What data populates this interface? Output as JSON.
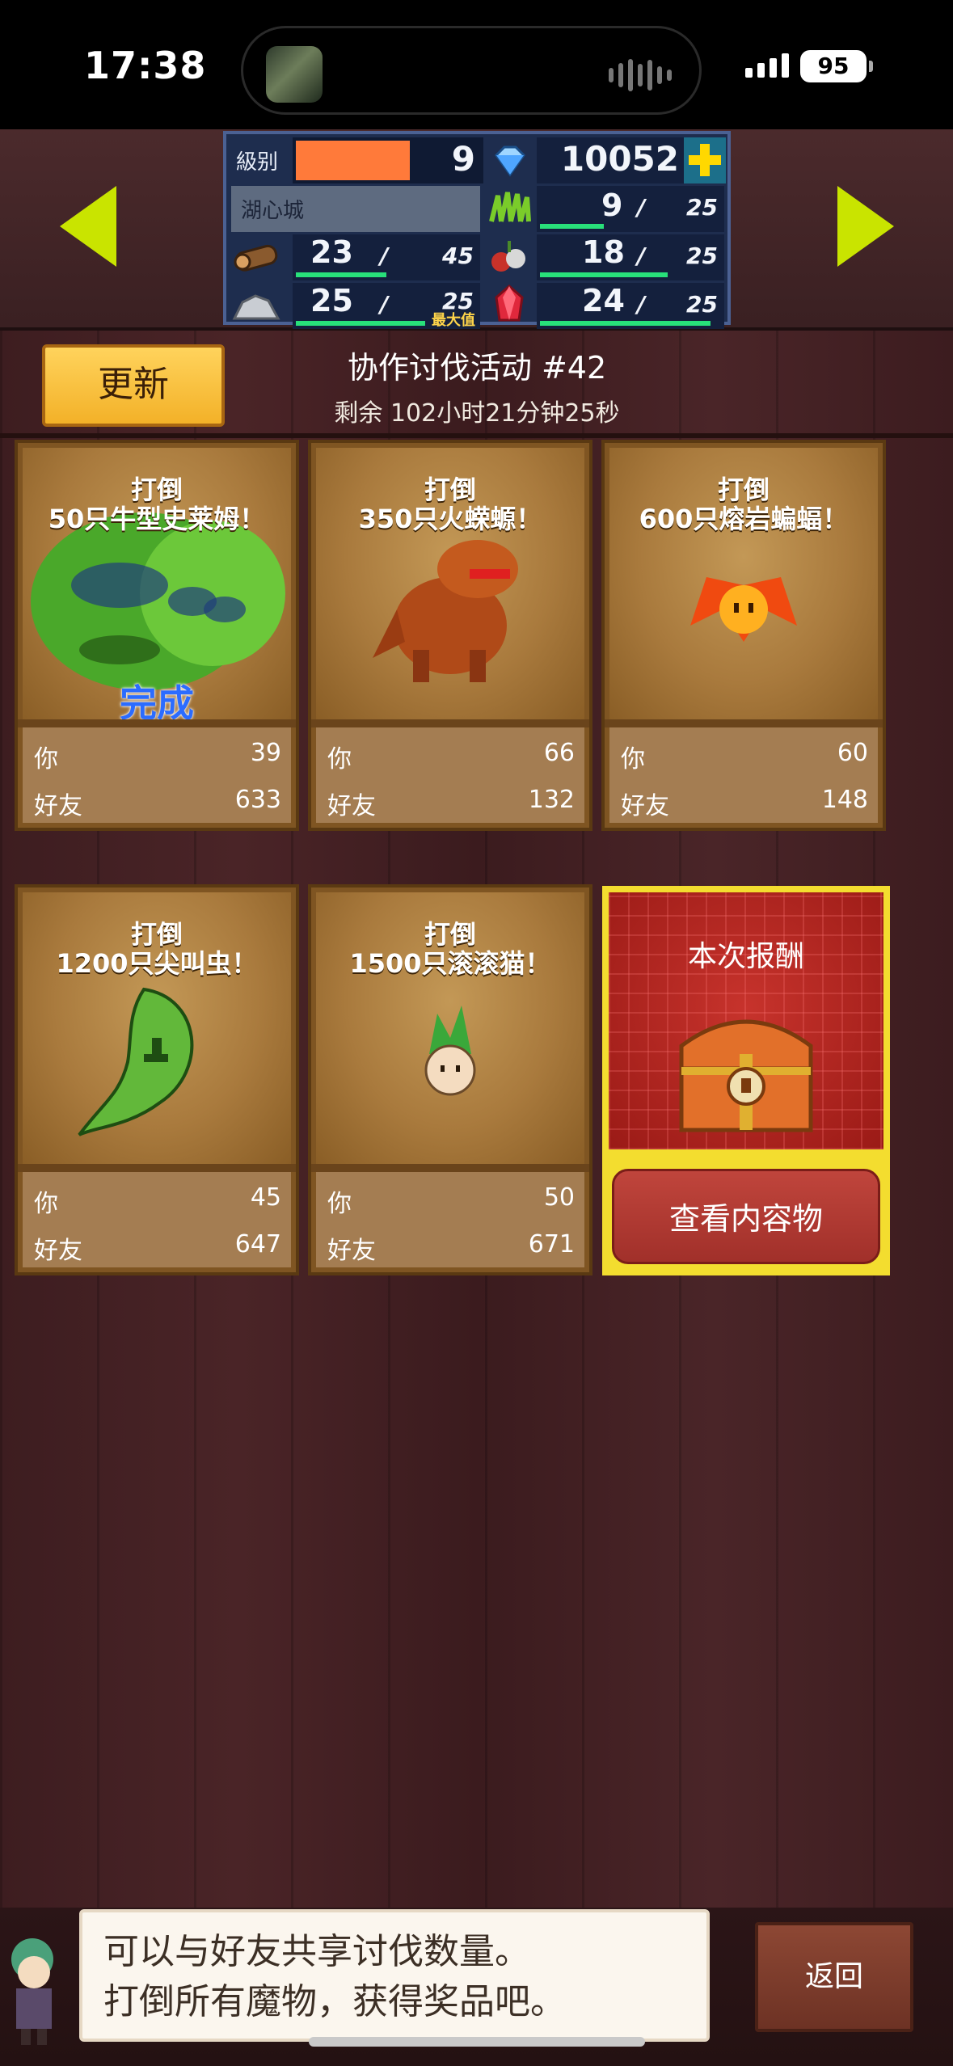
{
  "status_bar": {
    "time": "17:38",
    "battery": "95"
  },
  "stats": {
    "level_label": "級别",
    "level_value": "9",
    "gems": "10052",
    "town_name": "湖心城",
    "wood": {
      "value": "23",
      "max": "45",
      "progress": 0.51
    },
    "stone": {
      "value": "25",
      "max": "25",
      "note": "最大值",
      "progress": 1.0
    },
    "grass": {
      "value": "9",
      "max": "25",
      "progress": 0.36
    },
    "fruit": {
      "value": "18",
      "max": "25",
      "progress": 0.72
    },
    "ruby": {
      "value": "24",
      "max": "25",
      "progress": 0.96
    },
    "level_progress": 0.62
  },
  "header": {
    "refresh_label": "更新",
    "event_title": "协作讨伐活动 #42",
    "remaining": "剩余 102小时21分钟25秒"
  },
  "cards": [
    {
      "title": "打倒",
      "target": "50只牛型史莱姆！",
      "you_label": "你",
      "you": "39",
      "friend_label": "好友",
      "friend": "633",
      "done": "完成"
    },
    {
      "title": "打倒",
      "target": "350只火蝾螈！",
      "you_label": "你",
      "you": "66",
      "friend_label": "好友",
      "friend": "132"
    },
    {
      "title": "打倒",
      "target": "600只熔岩蝙蝠！",
      "you_label": "你",
      "you": "60",
      "friend_label": "好友",
      "friend": "148"
    },
    {
      "title": "打倒",
      "target": "1200只尖叫虫！",
      "you_label": "你",
      "you": "45",
      "friend_label": "好友",
      "friend": "647"
    },
    {
      "title": "打倒",
      "target": "1500只滚滚猫！",
      "you_label": "你",
      "you": "50",
      "friend_label": "好友",
      "friend": "671"
    }
  ],
  "reward": {
    "title": "本次报酬",
    "button": "查看内容物"
  },
  "footer": {
    "message_line1": "可以与好友共享讨伐数量。",
    "message_line2": "打倒所有魔物，获得奖品吧。",
    "back_label": "返回"
  },
  "colors": {
    "accent_yellow": "#c9e400",
    "progress_green": "#28e07a",
    "level_orange": "#ff7a3a",
    "panel_blue": "#1e2d4e"
  }
}
